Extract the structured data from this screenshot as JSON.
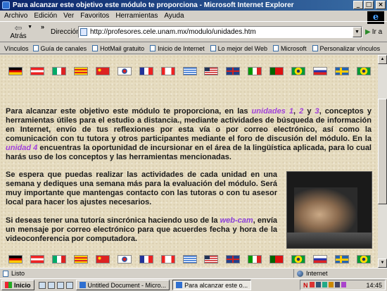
{
  "window": {
    "title": "Para alcanzar este objetivo este módulo te proporciona - Microsoft Internet Explorer",
    "btn_min": "_",
    "btn_max": "□",
    "btn_close": "×",
    "ie_logo": "e"
  },
  "menu": [
    "Archivo",
    "Edición",
    "Ver",
    "Favoritos",
    "Herramientas",
    "Ayuda"
  ],
  "toolbar": {
    "back_label": "Atrás",
    "back_arrow": "⇦",
    "back_dropdown": "▼",
    "chevron": "»",
    "address_label": "Dirección",
    "address_value": "http://profesores.cele.unam.mx/modulo/unidades.htm",
    "address_dropdown": "▼",
    "go_arrow": "▶",
    "go_label": "Ir a"
  },
  "links_bar": {
    "label": "Vínculos",
    "items": [
      "Guía de canales",
      "HotMail gratuito",
      "Inicio de Internet",
      "Lo mejor del Web",
      "Microsoft",
      "Personalizar vínculos"
    ]
  },
  "flags": [
    "germany",
    "austria",
    "mexico",
    "catalonia",
    "china",
    "south-korea",
    "france",
    "canada",
    "greece",
    "usa",
    "united-kingdom",
    "italy",
    "portugal",
    "brazil",
    "russia",
    "sweden",
    "brazil-2"
  ],
  "content": {
    "p1_a": "Para alcanzar este objetivo este módulo te proporciona, en las ",
    "p1_u1": "unidades 1",
    "p1_comma": ", ",
    "p1_u2": "2",
    "p1_y": " y ",
    "p1_u3": "3",
    "p1_b": ", conceptos y herramientas útiles para el estudio a distancia., mediante actividades de búsqueda de información en Internet, envío de tus reflexiones por esta vía o por correo electrónico, así como la comunicación con tu tutora y otros participantes mediante el foro de discusión del módulo. En la ",
    "p1_u4": "unidad 4",
    "p1_c": " encuentras la oportunidad de incursionar en el área de la lingüística aplicada, para lo cual harás uso de los conceptos y las herramientas mencionadas.",
    "p2": "Se espera que puedas realizar las actividades de cada unidad en una semana y dediques una semana más para la evaluación del módulo. Será muy importante que mantengas contacto con las tutoras o con tu asesor local para hacer los ajustes necesarios.",
    "p3_a": "Si deseas tener una tutoría sincrónica haciendo uso de la ",
    "p3_link": "web-cam",
    "p3_b": ", envía un mensaje por correo electrónico para que acuerdes fecha y hora de la videoconferencia por computadora."
  },
  "scrollbar": {
    "up": "▲",
    "down": "▼"
  },
  "status": {
    "left": "Listo",
    "zone": "Internet"
  },
  "taskbar": {
    "start": "Inicio",
    "tasks": [
      "Untitled Document - Micro...",
      "Para alcanzar este o..."
    ],
    "tray_letter": "N",
    "clock": "14:45"
  }
}
